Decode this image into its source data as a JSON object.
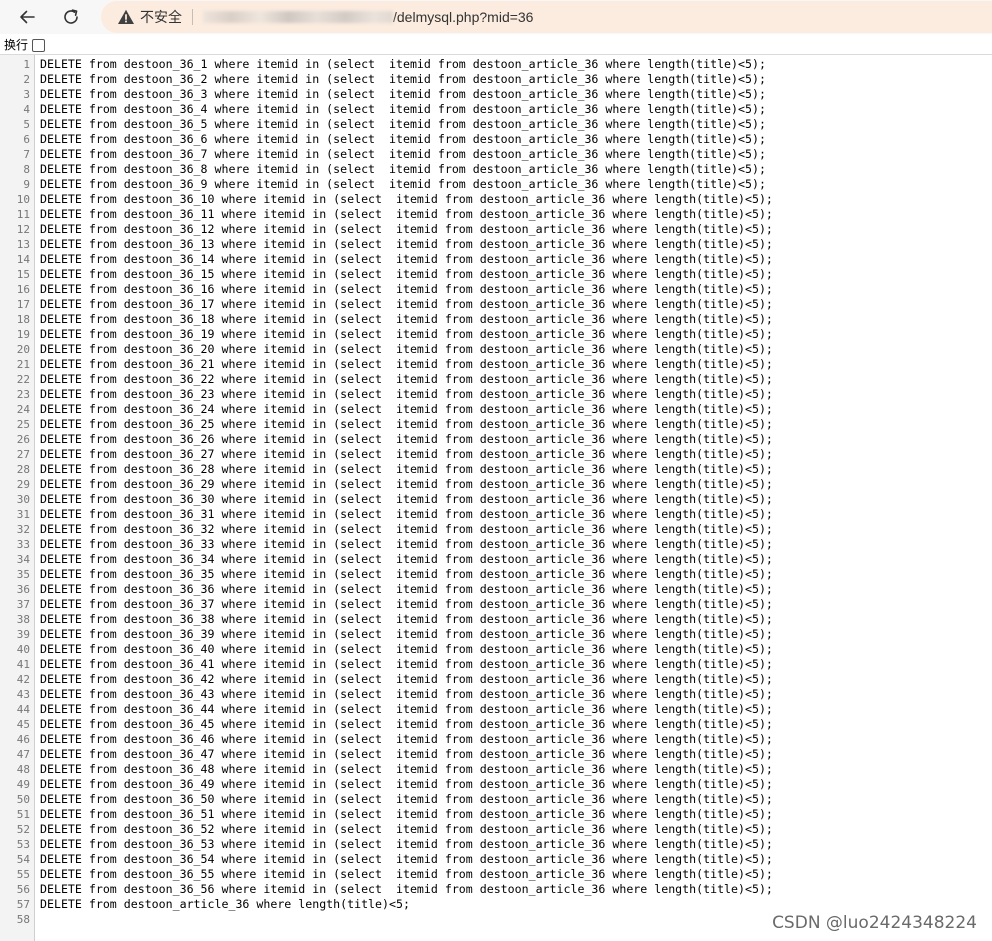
{
  "browser": {
    "security_label": "不安全",
    "url_visible": "/delmysql.php?mid=36"
  },
  "options": {
    "wrap_label": "换行",
    "wrap_checked": false
  },
  "source_lines": [
    "DELETE from destoon_36_1 where itemid in (select  itemid from destoon_article_36 where length(title)<5);",
    "DELETE from destoon_36_2 where itemid in (select  itemid from destoon_article_36 where length(title)<5);",
    "DELETE from destoon_36_3 where itemid in (select  itemid from destoon_article_36 where length(title)<5);",
    "DELETE from destoon_36_4 where itemid in (select  itemid from destoon_article_36 where length(title)<5);",
    "DELETE from destoon_36_5 where itemid in (select  itemid from destoon_article_36 where length(title)<5);",
    "DELETE from destoon_36_6 where itemid in (select  itemid from destoon_article_36 where length(title)<5);",
    "DELETE from destoon_36_7 where itemid in (select  itemid from destoon_article_36 where length(title)<5);",
    "DELETE from destoon_36_8 where itemid in (select  itemid from destoon_article_36 where length(title)<5);",
    "DELETE from destoon_36_9 where itemid in (select  itemid from destoon_article_36 where length(title)<5);",
    "DELETE from destoon_36_10 where itemid in (select  itemid from destoon_article_36 where length(title)<5);",
    "DELETE from destoon_36_11 where itemid in (select  itemid from destoon_article_36 where length(title)<5);",
    "DELETE from destoon_36_12 where itemid in (select  itemid from destoon_article_36 where length(title)<5);",
    "DELETE from destoon_36_13 where itemid in (select  itemid from destoon_article_36 where length(title)<5);",
    "DELETE from destoon_36_14 where itemid in (select  itemid from destoon_article_36 where length(title)<5);",
    "DELETE from destoon_36_15 where itemid in (select  itemid from destoon_article_36 where length(title)<5);",
    "DELETE from destoon_36_16 where itemid in (select  itemid from destoon_article_36 where length(title)<5);",
    "DELETE from destoon_36_17 where itemid in (select  itemid from destoon_article_36 where length(title)<5);",
    "DELETE from destoon_36_18 where itemid in (select  itemid from destoon_article_36 where length(title)<5);",
    "DELETE from destoon_36_19 where itemid in (select  itemid from destoon_article_36 where length(title)<5);",
    "DELETE from destoon_36_20 where itemid in (select  itemid from destoon_article_36 where length(title)<5);",
    "DELETE from destoon_36_21 where itemid in (select  itemid from destoon_article_36 where length(title)<5);",
    "DELETE from destoon_36_22 where itemid in (select  itemid from destoon_article_36 where length(title)<5);",
    "DELETE from destoon_36_23 where itemid in (select  itemid from destoon_article_36 where length(title)<5);",
    "DELETE from destoon_36_24 where itemid in (select  itemid from destoon_article_36 where length(title)<5);",
    "DELETE from destoon_36_25 where itemid in (select  itemid from destoon_article_36 where length(title)<5);",
    "DELETE from destoon_36_26 where itemid in (select  itemid from destoon_article_36 where length(title)<5);",
    "DELETE from destoon_36_27 where itemid in (select  itemid from destoon_article_36 where length(title)<5);",
    "DELETE from destoon_36_28 where itemid in (select  itemid from destoon_article_36 where length(title)<5);",
    "DELETE from destoon_36_29 where itemid in (select  itemid from destoon_article_36 where length(title)<5);",
    "DELETE from destoon_36_30 where itemid in (select  itemid from destoon_article_36 where length(title)<5);",
    "DELETE from destoon_36_31 where itemid in (select  itemid from destoon_article_36 where length(title)<5);",
    "DELETE from destoon_36_32 where itemid in (select  itemid from destoon_article_36 where length(title)<5);",
    "DELETE from destoon_36_33 where itemid in (select  itemid from destoon_article_36 where length(title)<5);",
    "DELETE from destoon_36_34 where itemid in (select  itemid from destoon_article_36 where length(title)<5);",
    "DELETE from destoon_36_35 where itemid in (select  itemid from destoon_article_36 where length(title)<5);",
    "DELETE from destoon_36_36 where itemid in (select  itemid from destoon_article_36 where length(title)<5);",
    "DELETE from destoon_36_37 where itemid in (select  itemid from destoon_article_36 where length(title)<5);",
    "DELETE from destoon_36_38 where itemid in (select  itemid from destoon_article_36 where length(title)<5);",
    "DELETE from destoon_36_39 where itemid in (select  itemid from destoon_article_36 where length(title)<5);",
    "DELETE from destoon_36_40 where itemid in (select  itemid from destoon_article_36 where length(title)<5);",
    "DELETE from destoon_36_41 where itemid in (select  itemid from destoon_article_36 where length(title)<5);",
    "DELETE from destoon_36_42 where itemid in (select  itemid from destoon_article_36 where length(title)<5);",
    "DELETE from destoon_36_43 where itemid in (select  itemid from destoon_article_36 where length(title)<5);",
    "DELETE from destoon_36_44 where itemid in (select  itemid from destoon_article_36 where length(title)<5);",
    "DELETE from destoon_36_45 where itemid in (select  itemid from destoon_article_36 where length(title)<5);",
    "DELETE from destoon_36_46 where itemid in (select  itemid from destoon_article_36 where length(title)<5);",
    "DELETE from destoon_36_47 where itemid in (select  itemid from destoon_article_36 where length(title)<5);",
    "DELETE from destoon_36_48 where itemid in (select  itemid from destoon_article_36 where length(title)<5);",
    "DELETE from destoon_36_49 where itemid in (select  itemid from destoon_article_36 where length(title)<5);",
    "DELETE from destoon_36_50 where itemid in (select  itemid from destoon_article_36 where length(title)<5);",
    "DELETE from destoon_36_51 where itemid in (select  itemid from destoon_article_36 where length(title)<5);",
    "DELETE from destoon_36_52 where itemid in (select  itemid from destoon_article_36 where length(title)<5);",
    "DELETE from destoon_36_53 where itemid in (select  itemid from destoon_article_36 where length(title)<5);",
    "DELETE from destoon_36_54 where itemid in (select  itemid from destoon_article_36 where length(title)<5);",
    "DELETE from destoon_36_55 where itemid in (select  itemid from destoon_article_36 where length(title)<5);",
    "DELETE from destoon_36_56 where itemid in (select  itemid from destoon_article_36 where length(title)<5);",
    "DELETE from destoon_article_36 where length(title)<5;",
    ""
  ],
  "watermark": "CSDN @luo2424348224",
  "icons": {
    "back": "back-arrow-icon",
    "reload": "reload-icon",
    "security": "warning-triangle-icon"
  }
}
